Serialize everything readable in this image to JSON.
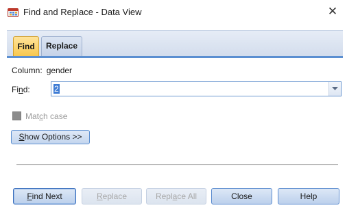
{
  "window": {
    "title": "Find and Replace - Data View",
    "close_glyph": "✕",
    "app_icon": "spss-data-icon"
  },
  "tabs": [
    {
      "label": "Find",
      "active": true
    },
    {
      "label": "Replace",
      "active": false
    }
  ],
  "column": {
    "label": "Column:",
    "value": "gender"
  },
  "find": {
    "label_pre": "Fi",
    "label_mnemonic": "n",
    "label_post": "d:",
    "value": "2"
  },
  "match_case": {
    "label_pre": "Mat",
    "label_mnemonic": "c",
    "label_post": "h case",
    "checked": false,
    "enabled": false
  },
  "show_options": {
    "mnemonic": "S",
    "label_post": "how Options >>"
  },
  "buttons": {
    "find_next": {
      "mnemonic": "F",
      "rest": "ind Next",
      "enabled": true
    },
    "replace": {
      "mnemonic": "R",
      "rest": "eplace",
      "enabled": false
    },
    "replace_all": {
      "pre": "Repl",
      "mnemonic": "a",
      "post": "ce All",
      "enabled": false
    },
    "close": {
      "label": "Close",
      "enabled": true
    },
    "help": {
      "label": "Help",
      "enabled": true
    }
  },
  "colors": {
    "accent_blue": "#5b8fd1",
    "active_tab": "#f7c64a",
    "selection": "#3d7bd4"
  }
}
